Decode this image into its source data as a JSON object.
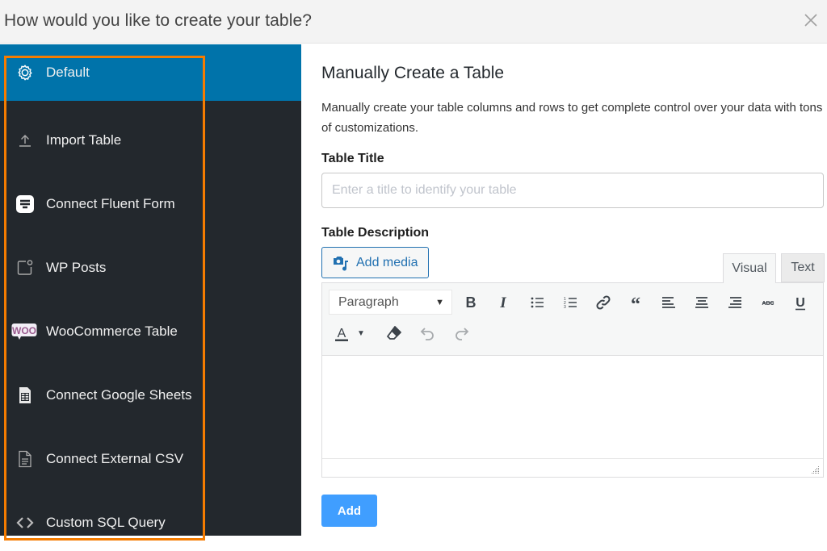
{
  "header": {
    "title": "How would you like to create your table?",
    "close_icon": "close-icon"
  },
  "sidebar": {
    "highlight_color": "#f57c00",
    "active_color": "#0073aa",
    "items": [
      {
        "label": "Default",
        "icon": "gear-icon",
        "active": true
      },
      {
        "label": "Import Table",
        "icon": "upload-icon",
        "active": false
      },
      {
        "label": "Connect Fluent Form",
        "icon": "fluent-form-icon",
        "active": false
      },
      {
        "label": "WP Posts",
        "icon": "posts-icon",
        "active": false
      },
      {
        "label": "WooCommerce Table",
        "icon": "woocommerce-icon",
        "active": false
      },
      {
        "label": "Connect Google Sheets",
        "icon": "spreadsheet-icon",
        "active": false
      },
      {
        "label": "Connect External CSV",
        "icon": "document-icon",
        "active": false
      },
      {
        "label": "Custom SQL Query",
        "icon": "code-icon",
        "active": false
      }
    ]
  },
  "main": {
    "title": "Manually Create a Table",
    "description": "Manually create your table columns and rows to get complete control over your data with tons of customizations.",
    "table_title_label": "Table Title",
    "table_title_placeholder": "Enter a title to identify your table",
    "table_title_value": "",
    "table_description_label": "Table Description",
    "add_media_label": "Add media",
    "tabs": [
      {
        "label": "Visual",
        "active": true
      },
      {
        "label": "Text",
        "active": false
      }
    ],
    "toolbar": {
      "format_select": "Paragraph",
      "buttons": [
        "bold",
        "italic",
        "bullet-list",
        "numbered-list",
        "link",
        "blockquote",
        "align-left",
        "align-center",
        "align-right",
        "strikethrough",
        "underline",
        "text-color",
        "text-color-dropdown",
        "clear-formatting",
        "undo",
        "redo"
      ]
    },
    "add_button_label": "Add",
    "add_button_color": "#409eff"
  }
}
